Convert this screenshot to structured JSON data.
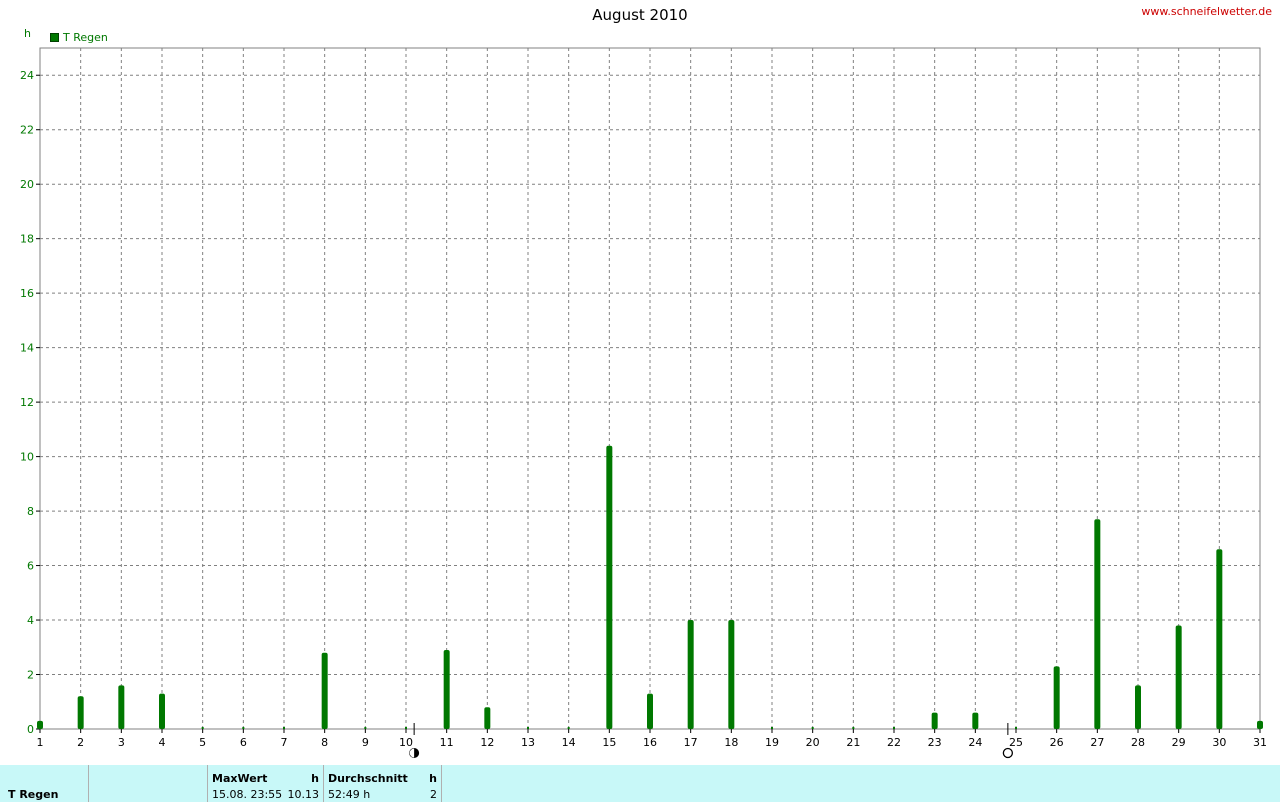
{
  "header": {
    "title": "August 2010",
    "site": "www.schneifelwetter.de",
    "unit": "h"
  },
  "legend": {
    "label": "T Regen",
    "color": "#007800"
  },
  "chart_data": {
    "type": "bar",
    "title": "August 2010",
    "ylabel": "h",
    "ylim": [
      0,
      25
    ],
    "yticks": [
      0,
      2,
      4,
      6,
      8,
      10,
      12,
      14,
      16,
      18,
      20,
      22,
      24
    ],
    "categories": [
      "1",
      "2",
      "3",
      "4",
      "5",
      "6",
      "7",
      "8",
      "9",
      "10",
      "11",
      "12",
      "13",
      "14",
      "15",
      "16",
      "17",
      "18",
      "19",
      "20",
      "21",
      "22",
      "23",
      "24",
      "25",
      "26",
      "27",
      "28",
      "29",
      "30",
      "31"
    ],
    "series": [
      {
        "name": "T Regen",
        "color": "#007800",
        "values": [
          0.3,
          1.2,
          1.6,
          1.3,
          0,
          0,
          0,
          2.8,
          0,
          0,
          2.9,
          0.8,
          0,
          0,
          10.4,
          1.3,
          4.0,
          4.0,
          0,
          0,
          0,
          0,
          0.6,
          0.6,
          0,
          2.3,
          7.7,
          1.6,
          3.8,
          6.6,
          0.3
        ]
      }
    ],
    "grid": true,
    "legend_position": "top-left",
    "moon_phases": [
      {
        "day": 10.2,
        "phase": "new-moon"
      },
      {
        "day": 24.8,
        "phase": "full-moon"
      }
    ]
  },
  "stats": {
    "series_name": "T Regen",
    "max_label": "MaxWert",
    "max_unit": "h",
    "max_datetime": "15.08.  23:55",
    "max_value": "10.13",
    "avg_label": "Durchschnitt",
    "avg_unit": "h",
    "avg_value": "52:49 h",
    "avg_extra": "2"
  }
}
